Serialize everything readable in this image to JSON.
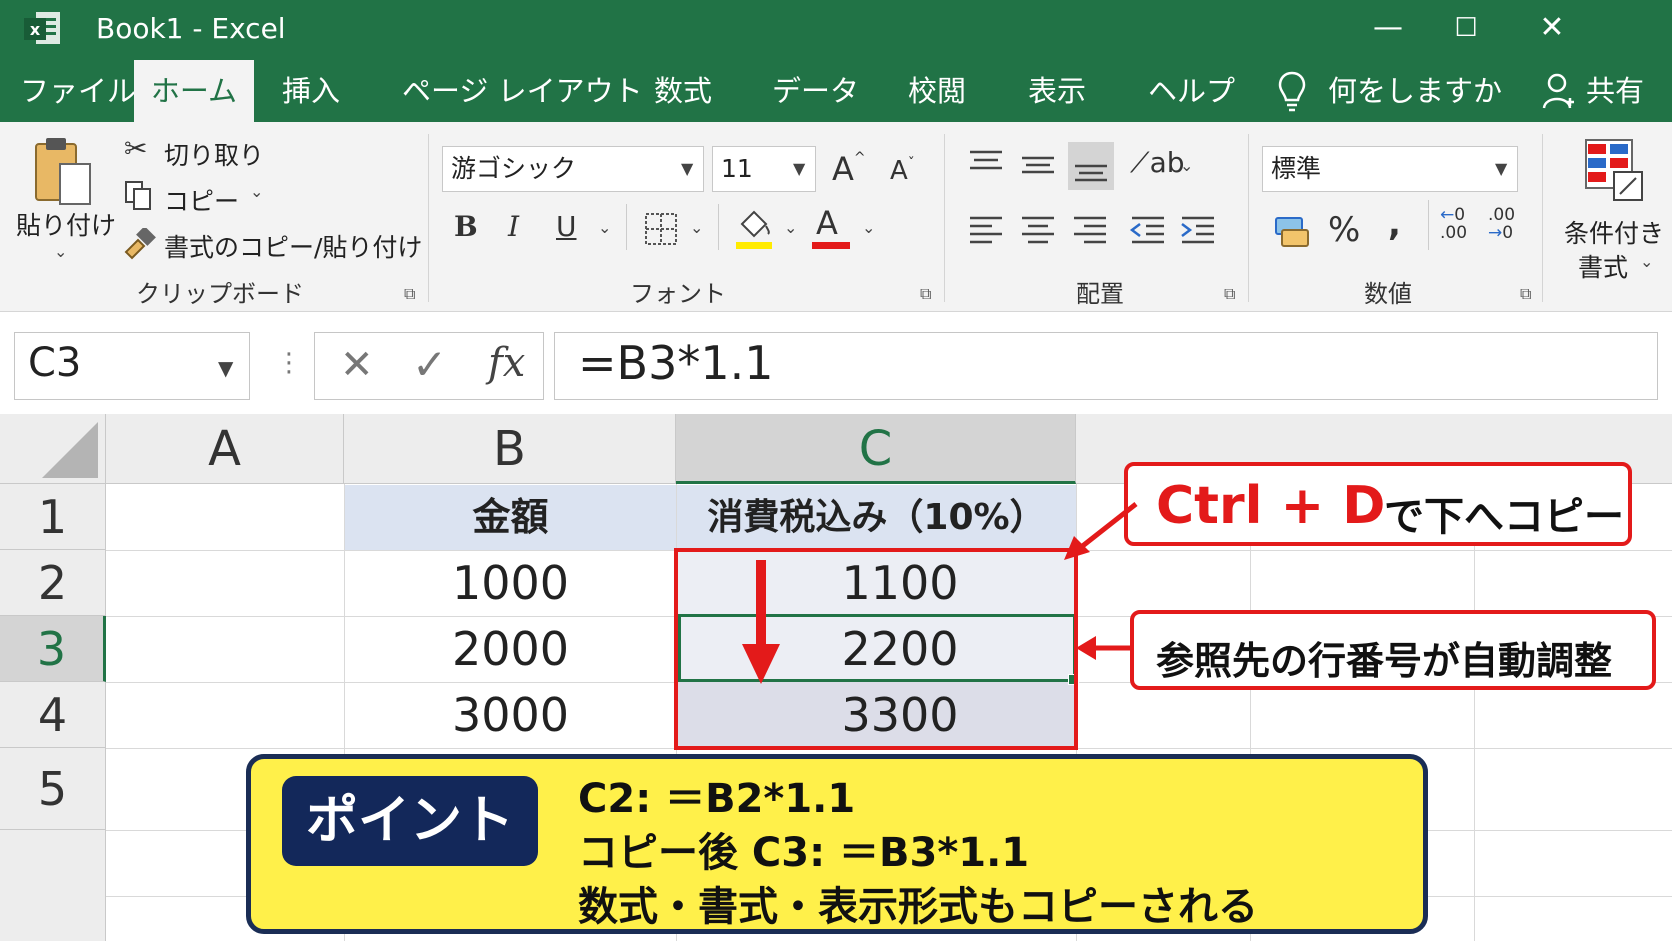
{
  "window": {
    "title": "Book1  -  Excel",
    "logo_letter": "x",
    "minimize": "—",
    "maximize": "☐",
    "close": "✕"
  },
  "ribbon_tabs": [
    {
      "label": "ファイル"
    },
    {
      "label": "ホーム",
      "active": true
    },
    {
      "label": "挿入"
    },
    {
      "label": "ページ レイアウト"
    },
    {
      "label": "数式"
    },
    {
      "label": "データ"
    },
    {
      "label": "校閲"
    },
    {
      "label": "表示"
    },
    {
      "label": "ヘルプ"
    }
  ],
  "tell_me": "何をしますか",
  "share": "共有",
  "clipboard": {
    "paste": "貼り付け",
    "cut": "切り取り",
    "copy": "コピー",
    "format_painter": "書式のコピー/貼り付け",
    "group_label": "クリップボード"
  },
  "font": {
    "name": "游ゴシック",
    "size": "11",
    "grow": "A",
    "shrink": "A",
    "bold": "B",
    "italic": "I",
    "underline": "U",
    "font_color_letter": "A",
    "group_label": "フォント"
  },
  "alignment": {
    "group_label": "配置"
  },
  "number": {
    "format": "標準",
    "percent": "%",
    "comma": ",",
    "inc_decimal": ".00",
    "dec_decimal": ".00",
    "group_label": "数値"
  },
  "styles": {
    "conditional_line1": "条件付き",
    "conditional_line2": "書式"
  },
  "formula_bar": {
    "name_box": "C3",
    "cancel": "✕",
    "enter": "✓",
    "fx": "fx",
    "formula": "=B3*1.1"
  },
  "sheet": {
    "columns": [
      "A",
      "B",
      "C"
    ],
    "rows": [
      "1",
      "2",
      "3",
      "4",
      "5"
    ],
    "selected_column": "C",
    "selected_row": "3",
    "cells": {
      "B1": "金額",
      "C1": "消費税込み（10%）",
      "B2": "1000",
      "C2": "1100",
      "B3": "2000",
      "C3": "2200",
      "B4": "3000",
      "C4": "3300"
    }
  },
  "callouts": {
    "ctrl_d_key": "Ctrl + D",
    "ctrl_d_text": "で下へコピー",
    "ref_adjust": "参照先の行番号が自動調整"
  },
  "point": {
    "badge": "ポイント",
    "line1": "C2: ＝B2*1.1",
    "line2": "コピー後 C3: ＝B3*1.1",
    "line3": "数式・書式・表示形式もコピーされる"
  },
  "colors": {
    "excel_green": "#217346",
    "callout_red": "#e31a1a",
    "point_yellow": "#fff04a",
    "point_navy": "#13285a",
    "header_fill": "#dbe3f1"
  }
}
